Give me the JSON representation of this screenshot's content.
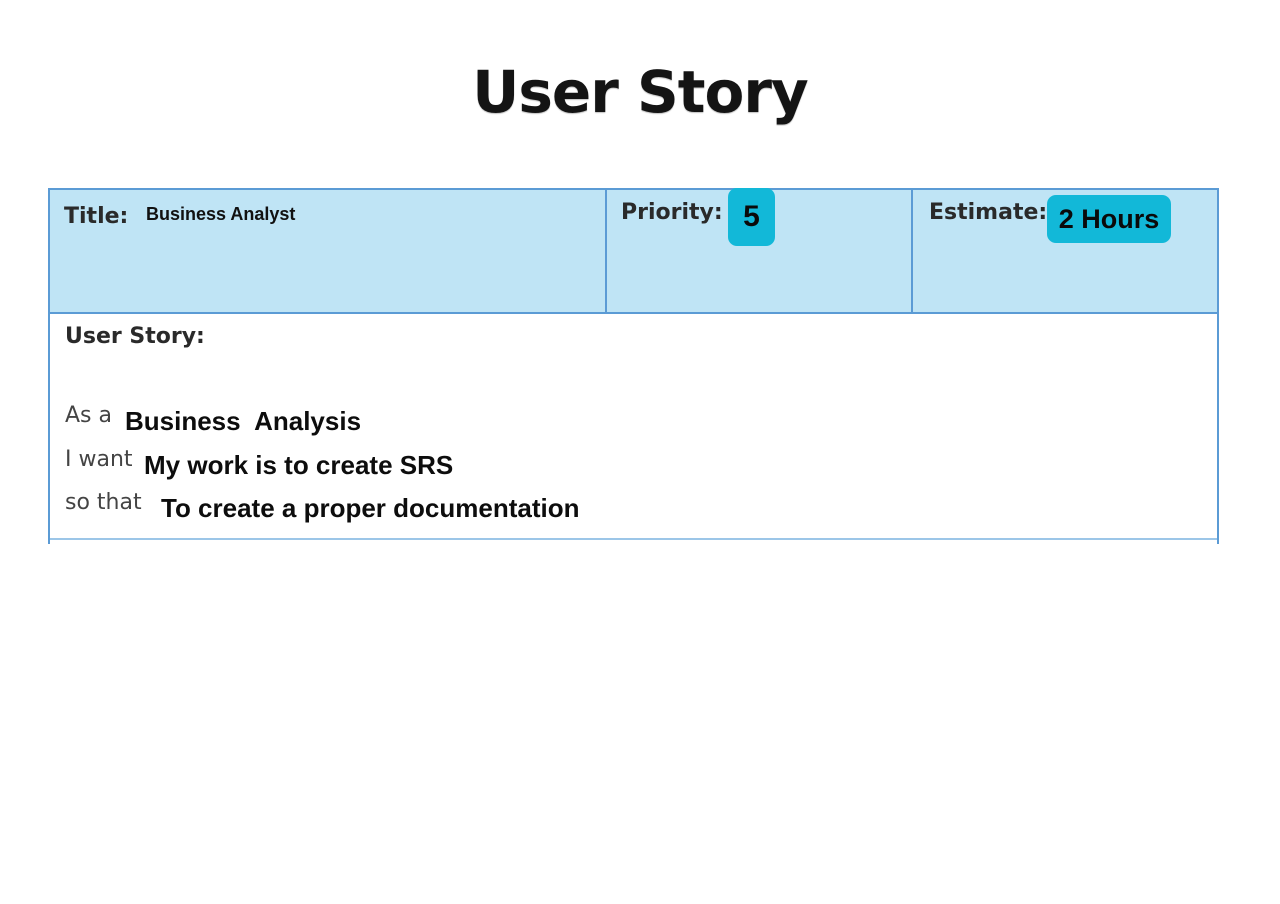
{
  "page": {
    "title": "User Story"
  },
  "header": {
    "title_label": "Title:",
    "title_value": "Business Analyst",
    "priority_label": "Priority:",
    "priority_value": "5",
    "estimate_label": "Estimate:",
    "estimate_value": "2 Hours"
  },
  "story": {
    "heading": "User Story:",
    "as_a_prefix": "As a",
    "as_a_value": "Business  Analysis",
    "i_want_prefix": "I want",
    "i_want_value": "My work is to create SRS",
    "so_that_prefix": "so that",
    "so_that_value": "To create a proper documentation"
  },
  "colors": {
    "header_fill": "#bfe4f5",
    "border": "#5b9bd5",
    "chip": "#12b8d8"
  }
}
